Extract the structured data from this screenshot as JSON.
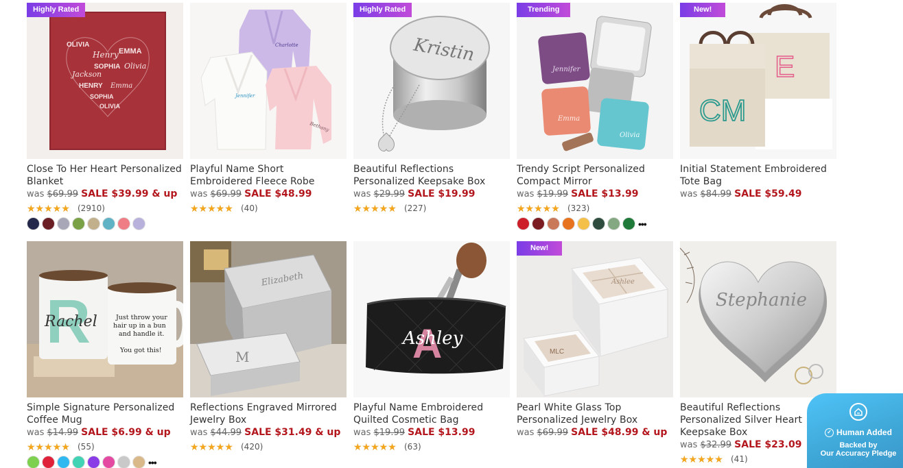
{
  "products": [
    {
      "badge": "Highly Rated",
      "title": "Close To Her Heart Personalized Blanket",
      "was_label": "was",
      "original_price": "$69.99",
      "sale_price": "SALE $39.99 & up",
      "rating": 4.5,
      "review_count": "(2910)",
      "swatches": [
        "#23284a",
        "#6b1e24",
        "#a7a7b7",
        "#7aa146",
        "#c2b08c",
        "#5fb3c4",
        "#ee7d86",
        "#b7b1db"
      ],
      "more_swatches": ""
    },
    {
      "badge": "",
      "title": "Playful Name Short Embroidered Fleece Robe",
      "was_label": "was",
      "original_price": "$69.99",
      "sale_price": "SALE $48.99",
      "rating": 4.5,
      "review_count": "(40)",
      "swatches": [],
      "more_swatches": ""
    },
    {
      "badge": "Highly Rated",
      "title": "Beautiful Reflections Personalized Keepsake Box",
      "was_label": "was",
      "original_price": "$29.99",
      "sale_price": "SALE $19.99",
      "rating": 4.5,
      "review_count": "(227)",
      "swatches": [],
      "more_swatches": ""
    },
    {
      "badge": "Trending",
      "title": "Trendy Script Personalized Compact Mirror",
      "was_label": "was",
      "original_price": "$19.99",
      "sale_price": "SALE $13.99",
      "rating": 5,
      "review_count": "(323)",
      "swatches": [
        "#cc1f2a",
        "#7b1c22",
        "#c9785a",
        "#e8731e",
        "#f4c04a",
        "#2f4d3f",
        "#84a882",
        "#1f7a3a"
      ],
      "more_swatches": "•••"
    },
    {
      "badge": "New!",
      "title": "Initial Statement Embroidered Tote Bag",
      "was_label": "was",
      "original_price": "$84.99",
      "sale_price": "SALE $59.49",
      "rating": null,
      "review_count": "",
      "swatches": [],
      "more_swatches": ""
    },
    {
      "badge": "",
      "title": "Simple Signature Personalized Coffee Mug",
      "was_label": "was",
      "original_price": "$14.99",
      "sale_price": "SALE $6.99 & up",
      "rating": 5,
      "review_count": "(55)",
      "swatches": [
        "#7dd14f",
        "#e0213a",
        "#2fb9f0",
        "#41d3b3",
        "#8a3ce6",
        "#e44aa2",
        "#c9c9c9",
        "#d9b98a"
      ],
      "more_swatches": "•••"
    },
    {
      "badge": "",
      "title": "Reflections Engraved Mirrored Jewelry Box",
      "was_label": "was",
      "original_price": "$44.99",
      "sale_price": "SALE $31.49 & up",
      "rating": 5,
      "review_count": "(420)",
      "swatches": [],
      "more_swatches": ""
    },
    {
      "badge": "",
      "title": "Playful Name Embroidered Quilted Cosmetic Bag",
      "was_label": "was",
      "original_price": "$19.99",
      "sale_price": "SALE $13.99",
      "rating": 4.5,
      "review_count": "(63)",
      "swatches": [],
      "more_swatches": ""
    },
    {
      "badge": "New!",
      "title": "Pearl White Glass Top Personalized Jewelry Box",
      "was_label": "was",
      "original_price": "$69.99",
      "sale_price": "SALE $48.99 & up",
      "rating": null,
      "review_count": "",
      "swatches": [],
      "more_swatches": ""
    },
    {
      "badge": "",
      "title": "Beautiful Reflections Personalized Silver Heart Keepsake Box",
      "was_label": "was",
      "original_price": "$32.99",
      "sale_price": "SALE $23.09",
      "rating": 5,
      "review_count": "(41)",
      "swatches": [],
      "more_swatches": ""
    }
  ],
  "product_art_text": {
    "blanket_names": [
      "OLIVIA",
      "Henry",
      "EMMA",
      "SOPHIA",
      "Olivia",
      "Jackson",
      "HENRY",
      "Emma"
    ],
    "robe_names": [
      "Charlotte",
      "Jennifer",
      "Bethany"
    ],
    "keepsake_name": "Kristin",
    "mirror_names": [
      "Jennifer",
      "Emma",
      "Olivia"
    ],
    "tote_monograms": [
      "CM",
      "E"
    ],
    "mug_initial": "R",
    "mug_name": "Rachel",
    "mug_quote": [
      "Just throw your",
      "hair up in a bun",
      "and handle it.",
      "You got this!"
    ],
    "jewelry_box_name": "Elizabeth",
    "jewelry_box_initial": "M",
    "cosmetic_initial": "A",
    "cosmetic_name": "Ashley",
    "pearl_box_name": "Ashlee",
    "pearl_box_monogram": "MLC",
    "heart_name": "Stephanie"
  },
  "pledge": {
    "line1": "Human Added",
    "line2": "Backed by",
    "line3": "Our Accuracy Pledge"
  },
  "colors": {
    "sale_red": "#b3171d",
    "badge_gradient_start": "#7a3de6",
    "badge_gradient_end": "#c14bd9",
    "star_gold": "#f4a61c",
    "pledge_blue": "#3fa8d8"
  }
}
